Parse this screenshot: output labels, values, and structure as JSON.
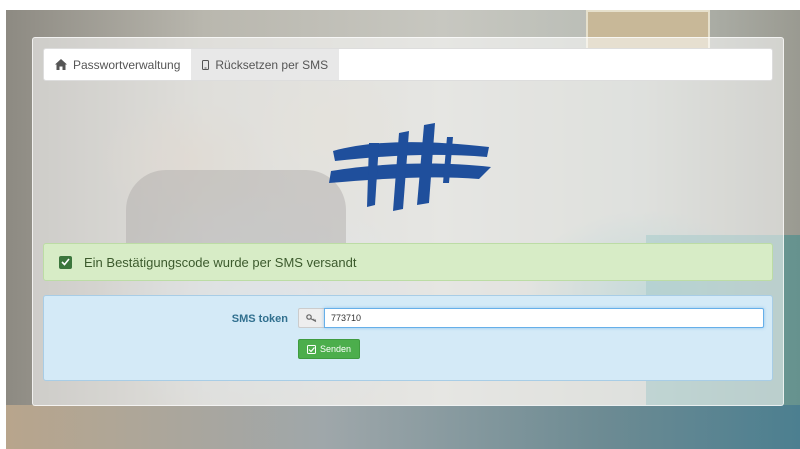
{
  "nav": {
    "tabs": [
      {
        "label": "Passwortverwaltung",
        "icon": "home-icon"
      },
      {
        "label": "Rücksetzen per SMS",
        "icon": "mobile-icon"
      }
    ]
  },
  "alert": {
    "message": "Ein Bestätigungscode wurde per SMS versandt",
    "icon": "check-square-icon"
  },
  "form": {
    "token_label": "SMS token",
    "token_value": "773710",
    "key_icon": "key-icon",
    "submit_label": "Senden",
    "submit_icon": "check-square-icon"
  },
  "colors": {
    "alert_bg": "#d7ecc6",
    "panel_bg": "#d4eaf7",
    "button": "#4cae4c",
    "logo": "#1f4f9c"
  }
}
